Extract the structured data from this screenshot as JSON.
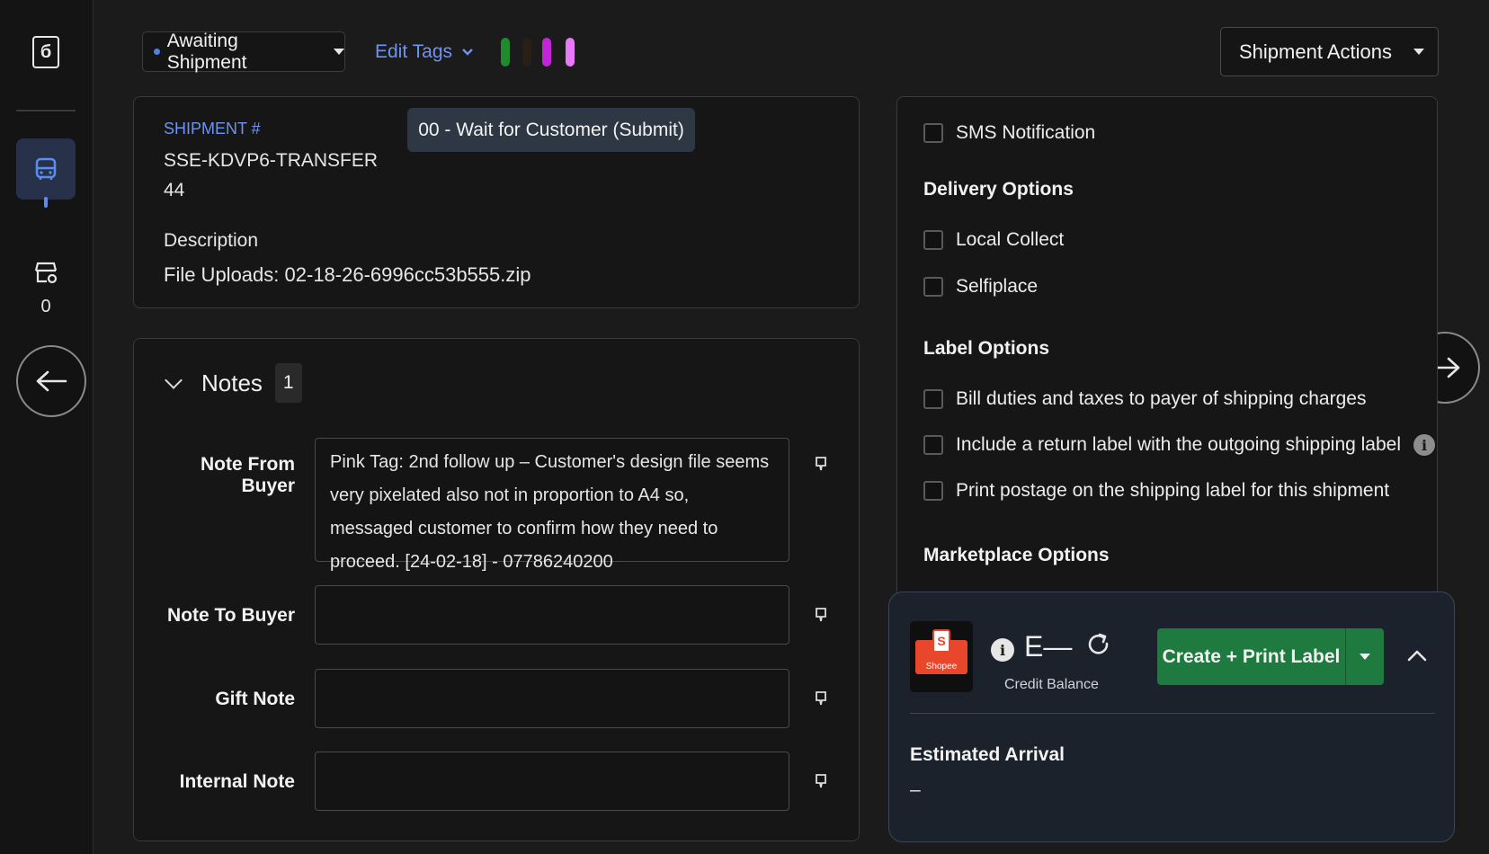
{
  "rail": {
    "logo_glyph": "б",
    "nav_count": "0"
  },
  "topbar": {
    "status_label": "Awaiting Shipment",
    "edit_tags_label": "Edit Tags",
    "tags": [
      {
        "color": "#1f8a2e"
      },
      {
        "color": "#2a1f16"
      },
      {
        "color": "#c026d3"
      },
      {
        "color": "#e879f9"
      }
    ],
    "shipment_actions_label": "Shipment Actions"
  },
  "shipment": {
    "number_label": "SHIPMENT #",
    "number_line1": "SSE-KDVP6-TRANSFER",
    "number_line2": "44",
    "status_pill": "00 - Wait for Customer (Submit)",
    "description_label": "Description",
    "file_uploads_label": "File Uploads:",
    "file_uploads_value": "02-18-26-6996cc53b555.zip"
  },
  "notes": {
    "title": "Notes",
    "count": "1",
    "items": [
      {
        "label": "Note From Buyer",
        "value": "Pink Tag: 2nd follow up – Customer's design file seems very pixelated also not in proportion to A4 so, messaged customer to confirm how they need to proceed. [24-02-18] - 07786240200"
      },
      {
        "label": "Note To Buyer",
        "value": ""
      },
      {
        "label": "Gift Note",
        "value": ""
      },
      {
        "label": "Internal Note",
        "value": ""
      }
    ]
  },
  "options": {
    "sms": "SMS Notification",
    "delivery_heading": "Delivery Options",
    "local_collect": "Local Collect",
    "selfiplace": "Selfiplace",
    "label_heading": "Label Options",
    "bill_duties": "Bill duties and taxes to payer of shipping charges",
    "return_label": "Include a return label with the outgoing shipping label",
    "print_postage": "Print postage on the shipping label for this shipment",
    "marketplace_heading": "Marketplace Options"
  },
  "label": {
    "carrier_logo_text": "Shopee",
    "carrier_logo_letter": "S",
    "balance_value": "E—",
    "balance_label": "Credit Balance",
    "create_label": "Create + Print Label",
    "estimated_heading": "Estimated Arrival",
    "estimated_value": "–"
  }
}
